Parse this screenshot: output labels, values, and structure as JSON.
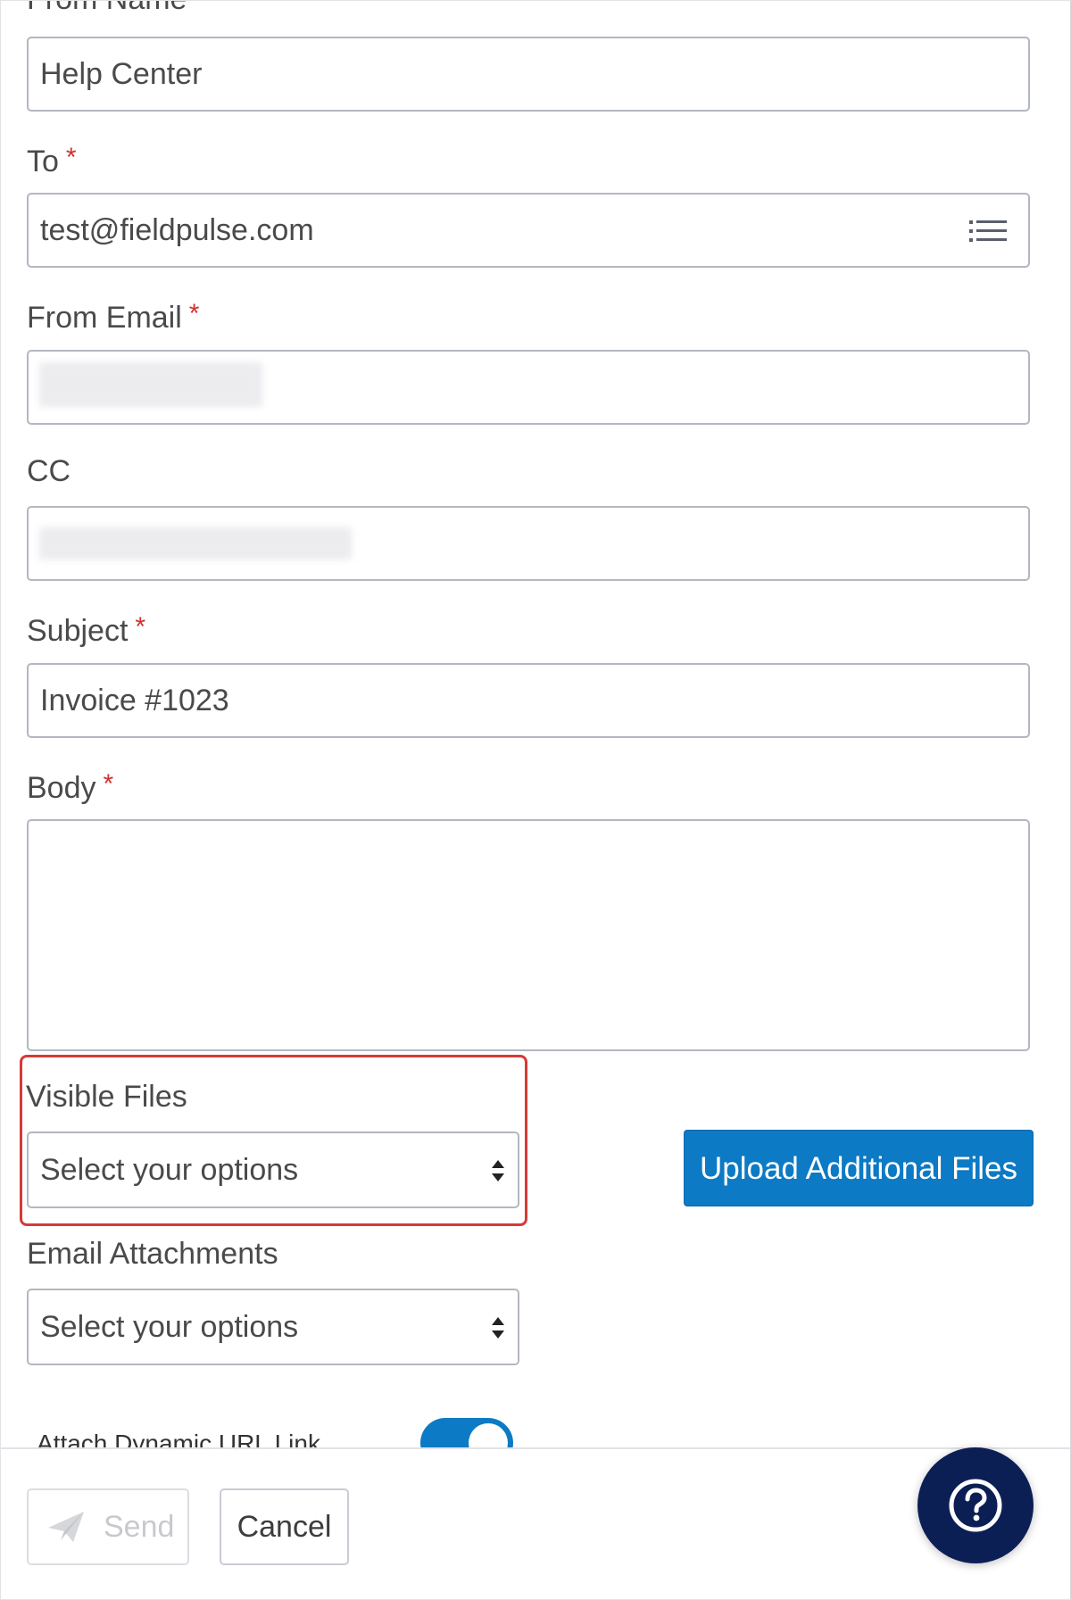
{
  "form": {
    "from_name": {
      "label": "From Name",
      "value": "Help Center"
    },
    "to": {
      "label": "To",
      "required_mark": "*",
      "value": "test@fieldpulse.com",
      "icon": "list-icon"
    },
    "from_email": {
      "label": "From Email",
      "required_mark": "*",
      "value": ""
    },
    "cc": {
      "label": "CC",
      "value": ""
    },
    "subject": {
      "label": "Subject",
      "required_mark": "*",
      "value": "Invoice #1023"
    },
    "body": {
      "label": "Body",
      "required_mark": "*",
      "value": ""
    },
    "visible_files": {
      "label": "Visible Files",
      "placeholder": "Select your options"
    },
    "email_attachments": {
      "label": "Email Attachments",
      "placeholder": "Select your options"
    },
    "upload_button": {
      "label": "Upload Additional Files"
    },
    "dynamic_url": {
      "label": "Attach Dynamic URL Link",
      "enabled": true
    }
  },
  "footer": {
    "send_label": "Send",
    "send_disabled": true,
    "cancel_label": "Cancel",
    "help_icon": "question-circle-icon"
  },
  "colors": {
    "accent": "#0c7ac4",
    "required": "#d0312d",
    "highlight": "#d63a36",
    "help_button": "#0b1f55"
  }
}
